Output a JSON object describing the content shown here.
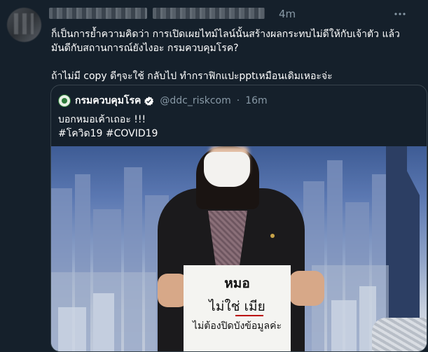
{
  "tweet": {
    "timestamp": "4m",
    "body_line1": "ก็เป็นการย้ำความคิดว่า การเปิดเผยไทม์ไลน์นั้นสร้างผลกระทบไม่ดีให้กับเจ้าตัว แล้ว",
    "body_line2": "มันดีกับสถานการณ์ยังไงอะ กรมควบคุมโรค?",
    "body_line3": "ถ้าไม่มี copy ดีๆจะใช้ กลับไป ทำกราฟิกแปะpptเหมือนเดิมเหอะจ่ะ"
  },
  "quoted_tweet": {
    "display_name": "กรมควบคุมโรค",
    "handle": "@ddc_riskcom",
    "separator": "·",
    "timestamp": "16m",
    "text_line1": "บอกหมอเค้าเถอะ !!!",
    "text_line2": "#โควิด19 #COVID19"
  },
  "sign": {
    "line1": "หมอ",
    "line2": "ไม่ใช่ เมีย",
    "line3": "ไม่ต้องปิดบังข้อมูลค่ะ"
  },
  "icons": {
    "more": "more-horizontal-icon",
    "verified": "verified-badge-icon"
  },
  "colors": {
    "background": "#15202b",
    "secondary_text": "#8899a6",
    "border": "#38444d",
    "verified": "#ffffff"
  }
}
